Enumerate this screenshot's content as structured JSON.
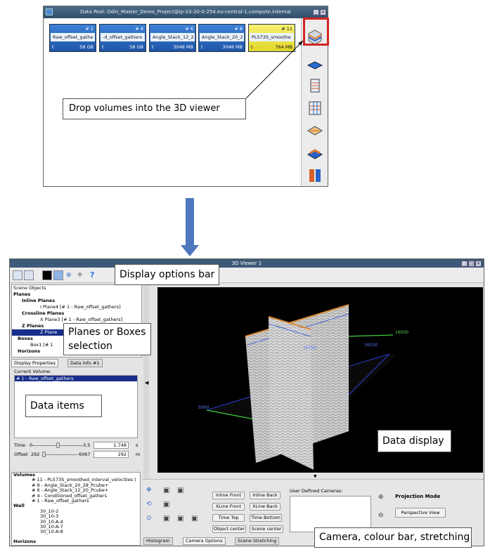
{
  "data_pool": {
    "title": "Data Pool: Odin_Master_Demo_Project@ip-10-20-0-254.eu-central-1.compute.internal",
    "volumes": [
      {
        "num": "# 1",
        "name": "Raw_offset_gathe",
        "t": "t",
        "size": "58 GB"
      },
      {
        "num": "# 4",
        "name": "-d_offset_gathers",
        "t": "t",
        "size": "58 GB"
      },
      {
        "num": "# 6",
        "name": "Angle_Stack_12_2",
        "t": "t",
        "size": "3048 MB"
      },
      {
        "num": "# 8",
        "name": "Angle_Stack_20_2",
        "t": "t",
        "size": "3048 MB"
      },
      {
        "num": "# 11",
        "name": "PL573S_smoothe",
        "t": "t",
        "size": "764 MB"
      }
    ]
  },
  "callouts": {
    "drop": "Drop volumes into the 3D viewer",
    "display_options": "Display options bar",
    "planes_boxes": "Planes or Boxes selection",
    "data_items": "Data items",
    "data_display": "Data display",
    "camera": "Camera, colour bar, stretching"
  },
  "viewer": {
    "title": "3D Viewer 1",
    "scene_objects_label": "Scene Objects",
    "tree": [
      "Planes",
      "Inline Planes",
      "I Plane4 [# 1 - Raw_offset_gathers]",
      "Crossline Planes",
      "X Plane3 [# 1 - Raw_offset_gathers]",
      "Z Planes",
      "Z Plane",
      "Boxes",
      "Box1 [# 1",
      "Horizons"
    ],
    "tabs": {
      "display_properties": "Display Properties",
      "data_info": "Data Info #1"
    },
    "current_volume_label": "Current Volume:",
    "current_volume": "# 1 - Raw_offset_gathers",
    "time": {
      "label": "Time",
      "min": "0",
      "max": "3.5",
      "value": "1.748",
      "unit": "s"
    },
    "offset": {
      "label": "Offset",
      "min": "292",
      "max": "6067",
      "value": "292",
      "unit": "m"
    },
    "lower_list": [
      "Volumes",
      "# 11 - PL573S_smoothed_interval_velocities (",
      "# 8 - Angle_Stack_20_28_Pcube+",
      "# 6 - Angle_Stack_12_20_Pcube+",
      "# 4 - Conditioned_offset_gathers",
      "# 1 - Raw_offset_gathers",
      "Well",
      "30_10-2",
      "30_10-3",
      "30_10-A-4",
      "30_10-A-7",
      "30_10-A-8",
      "Horizons"
    ],
    "axis_labels": {
      "a": "16250",
      "b": "16000",
      "c": "19750",
      "d": "5000"
    },
    "buttons": {
      "inline_front": "Inline Front",
      "inline_back": "Inline Back",
      "xline_front": "XLine Front",
      "xline_back": "XLine Back",
      "time_top": "Time Top",
      "time_bottom": "Time Bottom",
      "object_center": "Object center",
      "scene_center": "Scene center",
      "perspective": "Perspective View"
    },
    "user_cameras_label": "User Defined Cameras:",
    "projection_mode_label": "Projection Mode",
    "bottom_tabs": [
      "Histogram",
      "Camera Options",
      "Scene Stretching"
    ]
  }
}
